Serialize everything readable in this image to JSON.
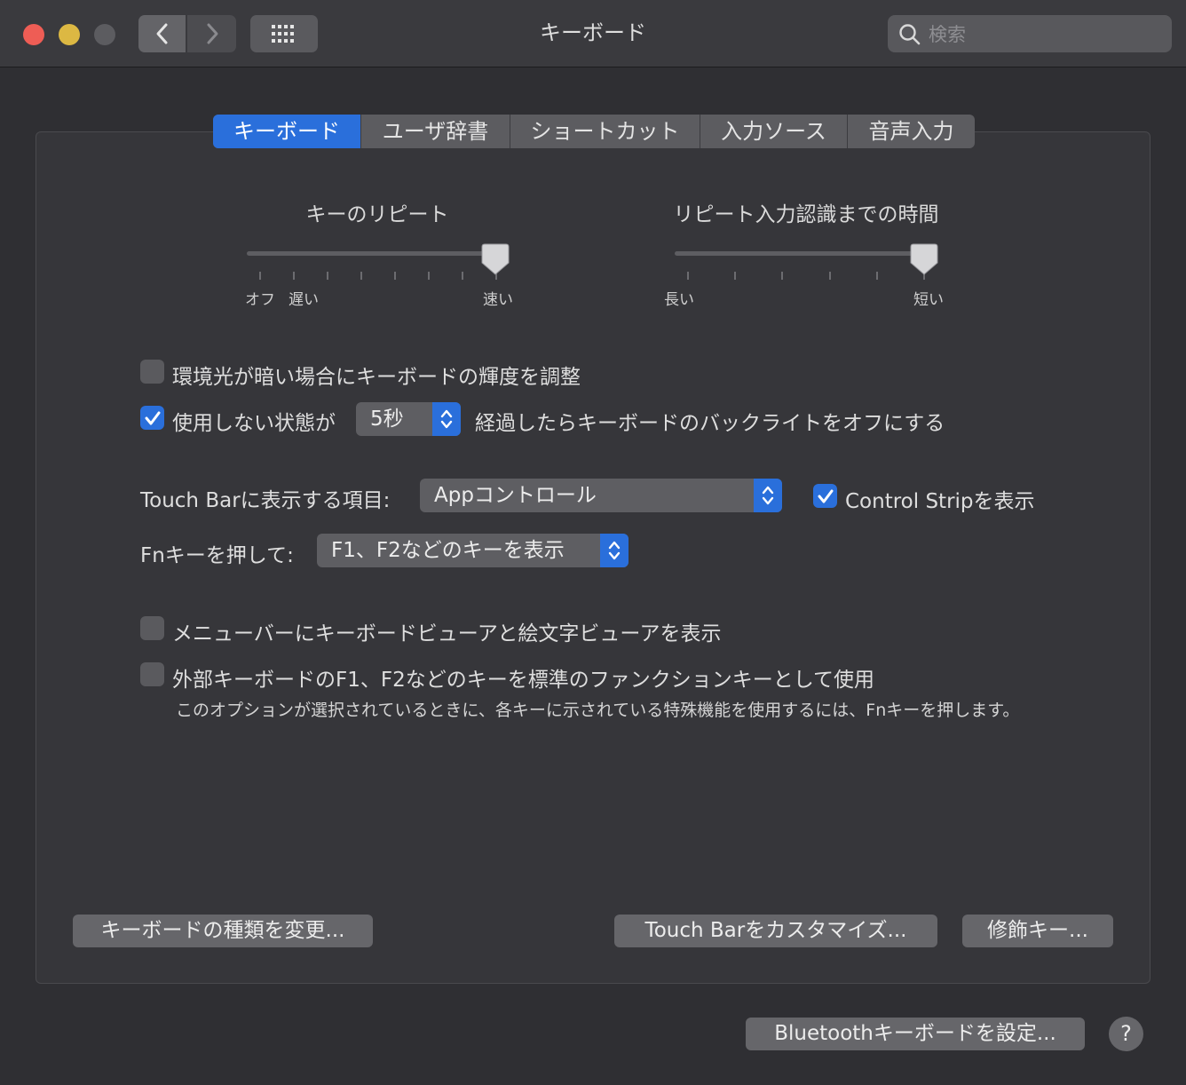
{
  "window": {
    "title": "キーボード",
    "search_placeholder": "検索"
  },
  "tabs": [
    {
      "label": "キーボード",
      "active": true
    },
    {
      "label": "ユーザ辞書",
      "active": false
    },
    {
      "label": "ショートカット",
      "active": false
    },
    {
      "label": "入力ソース",
      "active": false
    },
    {
      "label": "音声入力",
      "active": false
    }
  ],
  "sliders": {
    "key_repeat": {
      "title": "キーのリピート",
      "label_off": "オフ",
      "label_slow": "遅い",
      "label_fast": "速い",
      "value_fraction": 1.0
    },
    "repeat_delay": {
      "title": "リピート入力認識までの時間",
      "label_long": "長い",
      "label_short": "短い",
      "value_fraction": 1.0
    }
  },
  "options": {
    "adjust_brightness": {
      "label": "環境光が暗い場合にキーボードの輝度を調整",
      "checked": false
    },
    "backlight_off": {
      "label_before": "使用しない状態が",
      "value": "5秒",
      "label_after": "経過したらキーボードのバックライトをオフにする",
      "checked": true
    },
    "touchbar_items": {
      "label": "Touch Barに表示する項目:",
      "value": "Appコントロール"
    },
    "control_strip": {
      "label": "Control Stripを表示",
      "checked": true
    },
    "fn_key": {
      "label": "Fnキーを押して:",
      "value": "F1、F2などのキーを表示"
    },
    "menu_viewer": {
      "label": "メニューバーにキーボードビューアと絵文字ビューアを表示",
      "checked": false
    },
    "function_keys": {
      "label": "外部キーボードのF1、F2などのキーを標準のファンクションキーとして使用",
      "note": "このオプションが選択されているときに、各キーに示されている特殊機能を使用するには、Fnキーを押します。",
      "checked": false
    }
  },
  "buttons": {
    "change_type": "キーボードの種類を変更...",
    "customize_touchbar": "Touch Barをカスタマイズ...",
    "modifier_keys": "修飾キー...",
    "bluetooth": "Bluetoothキーボードを設定...",
    "help": "?"
  },
  "colors": {
    "accent": "#2a6fdb",
    "close": "#ee5d55",
    "minimize": "#dcb843"
  }
}
